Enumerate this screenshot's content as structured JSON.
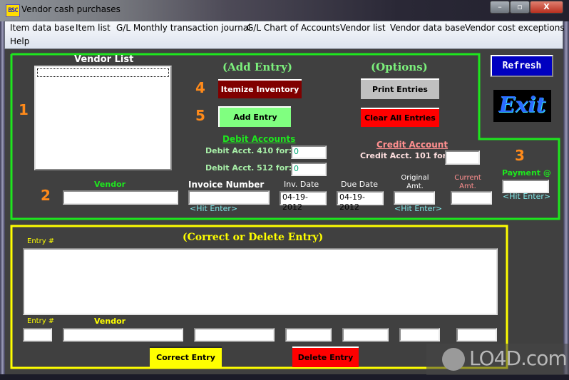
{
  "window": {
    "icon_text": "BSC",
    "title": "Vendor cash purchases",
    "controls": {
      "minimize": "–",
      "maximize": "▫",
      "close": "X"
    }
  },
  "menu": [
    "Item data base",
    "Item list",
    "G/L Monthly transaction journal",
    "G/L Chart of Accounts",
    "Vendor list",
    "Vendor data base",
    "Vendor cost exceptions",
    "Help"
  ],
  "add_panel": {
    "vendor_list_title": "Vendor List",
    "step_numbers": [
      "1",
      "2",
      "3",
      "4",
      "5"
    ],
    "add_entry_heading": "(Add Entry)",
    "options_heading": "(Options)",
    "itemize_inventory_label": "Itemize Inventory",
    "add_entry_label": "Add Entry",
    "print_entries_label": "Print Entries",
    "clear_all_entries_label": "Clear All Entries",
    "debit_heading": "Debit Accounts",
    "debit_410_label": "Debit Acct. 410 for:",
    "debit_410_value": "0",
    "debit_512_label": "Debit Acct. 512 for:",
    "debit_512_value": "0",
    "credit_heading": "Credit Account",
    "credit_101_label": "Credit Acct. 101 for:",
    "credit_101_value": "",
    "vendor_label": "Vendor",
    "vendor_value": "",
    "invoice_label": "Invoice Number",
    "invoice_value": "",
    "inv_date_label": "Inv. Date",
    "inv_date_value": "04-19-2012",
    "due_date_label": "Due Date",
    "due_date_value": "04-19-2012",
    "original_amt_label": "Original Amt.",
    "original_amt_value": "",
    "current_amt_label": "Current Amt.",
    "current_amt_value": "",
    "payment_label": "Payment @",
    "payment_value": "",
    "hit_enter": "<Hit Enter>"
  },
  "side": {
    "refresh_label": "Refresh",
    "exit_label": "Exit"
  },
  "correct_panel": {
    "heading": "(Correct or Delete Entry)",
    "entry_num_label": "Entry #",
    "entry_num_label2": "Entry #",
    "vendor_label": "Vendor",
    "correct_label": "Correct Entry",
    "delete_label": "Delete Entry"
  },
  "watermark": "LO4D.com"
}
